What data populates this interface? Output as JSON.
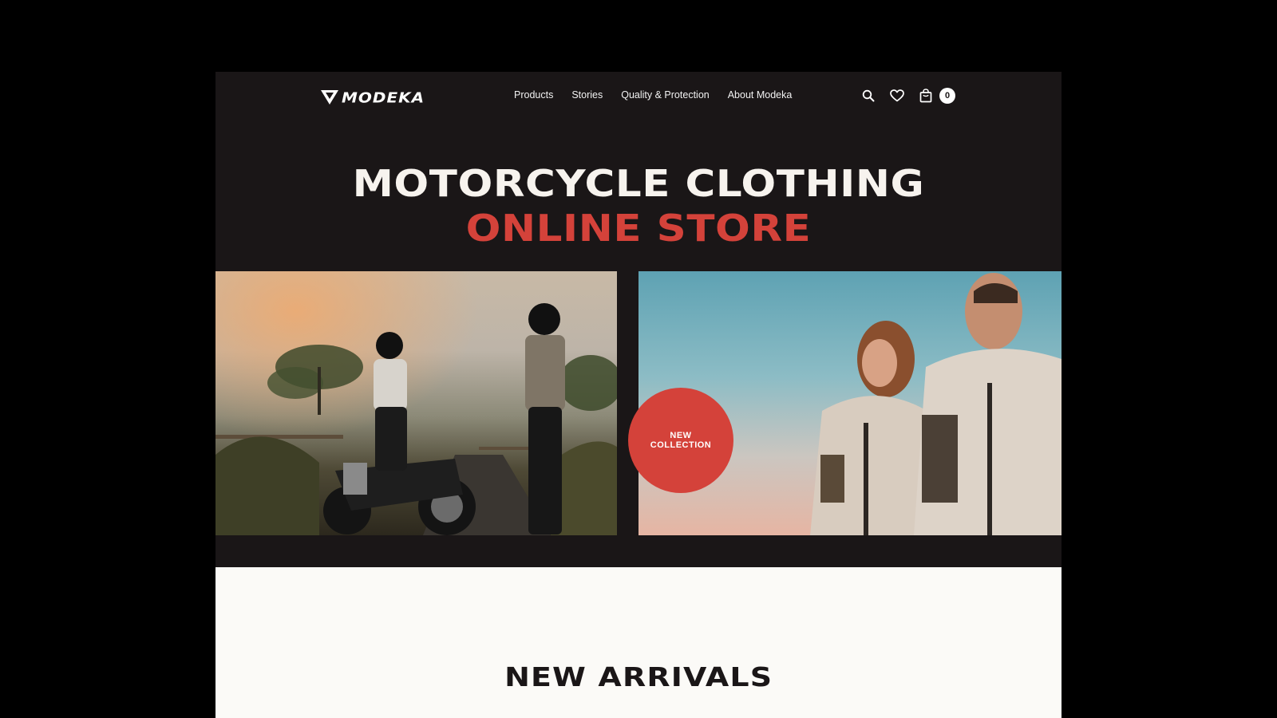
{
  "brand": {
    "name": "MODEKA",
    "logo_icon": "modeka-v-icon"
  },
  "nav": {
    "items": [
      {
        "label": "Products"
      },
      {
        "label": "Stories"
      },
      {
        "label": "Quality & Protection"
      },
      {
        "label": "About Modeka"
      }
    ],
    "icons": {
      "search": "search-icon",
      "wishlist": "heart-icon",
      "cart": "shopping-bag-icon"
    },
    "cart_count": "0"
  },
  "hero": {
    "title_line1": "MOTORCYCLE CLOTHING",
    "title_line2": "ONLINE STORE",
    "badge_line1": "NEW",
    "badge_line2": "COLLECTION"
  },
  "new_arrivals": {
    "title": "NEW ARRIVALS"
  },
  "colors": {
    "page_dark": "#1a1617",
    "accent_red": "#d4423a",
    "light_bg": "#fbfaf7",
    "text_light": "#f7f3ee"
  }
}
